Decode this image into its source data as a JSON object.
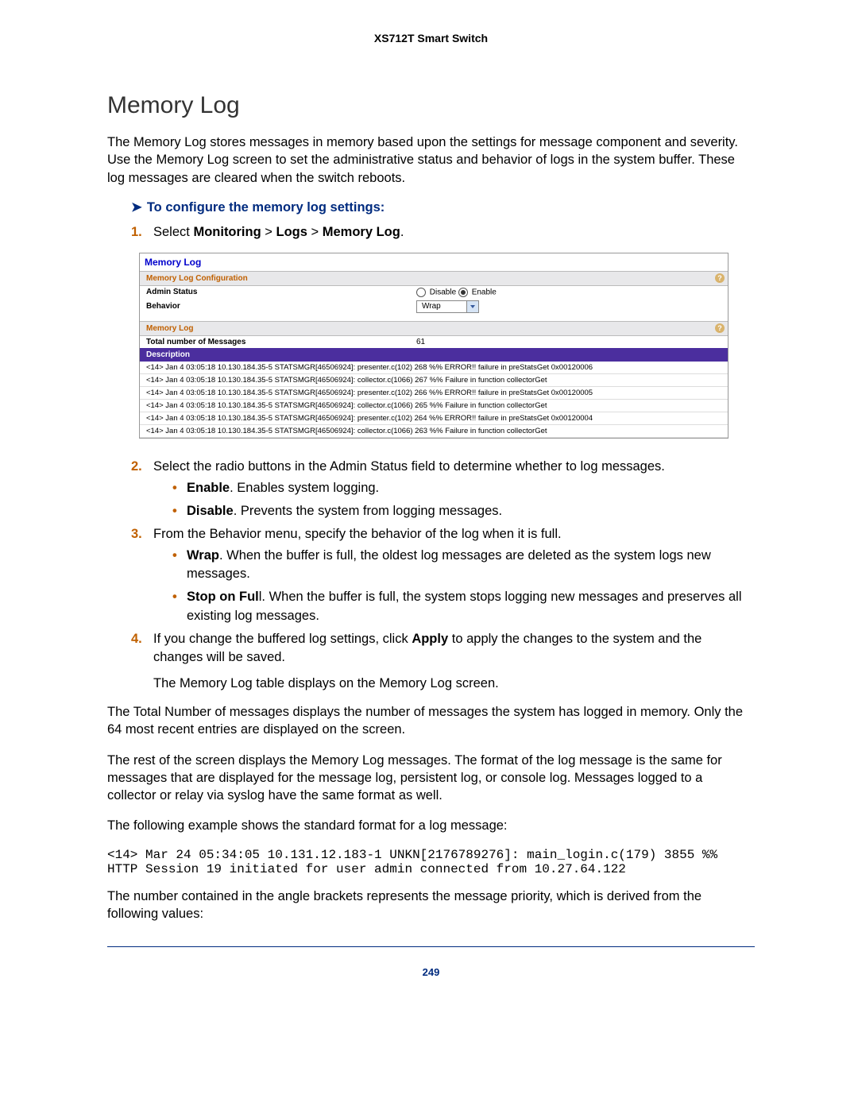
{
  "doc_header": "XS712T Smart Switch",
  "h1": "Memory Log",
  "intro": "The Memory Log stores messages in memory based upon the settings for message component and severity. Use the Memory Log screen to set the administrative status and behavior of logs in the system buffer. These log messages are cleared when the switch reboots.",
  "proc_title": "To configure the memory log settings:",
  "step1_a": "Select ",
  "step1_b": "Monitoring",
  "step1_c": " > ",
  "step1_d": "Logs",
  "step1_e": " > ",
  "step1_f": "Memory Log",
  "step1_g": ".",
  "screenshot": {
    "panel_title": "Memory Log",
    "section1": "Memory Log Configuration",
    "admin_status_label": "Admin Status",
    "disable_label": "Disable",
    "enable_label": "Enable",
    "behavior_label": "Behavior",
    "behavior_value": "Wrap",
    "section2": "Memory Log",
    "total_label": "Total number of Messages",
    "total_value": "61",
    "desc_head": "Description",
    "lines": [
      "<14> Jan 4 03:05:18 10.130.184.35-5 STATSMGR[46506924]: presenter.c(102) 268 %% ERROR!! failure in preStatsGet 0x00120006",
      "<14> Jan 4 03:05:18 10.130.184.35-5 STATSMGR[46506924]: collector.c(1066) 267 %% Failure in function collectorGet",
      "<14> Jan 4 03:05:18 10.130.184.35-5 STATSMGR[46506924]: presenter.c(102) 266 %% ERROR!! failure in preStatsGet 0x00120005",
      "<14> Jan 4 03:05:18 10.130.184.35-5 STATSMGR[46506924]: collector.c(1066) 265 %% Failure in function collectorGet",
      "<14> Jan 4 03:05:18 10.130.184.35-5 STATSMGR[46506924]: presenter.c(102) 264 %% ERROR!! failure in preStatsGet 0x00120004",
      "<14> Jan 4 03:05:18 10.130.184.35-5 STATSMGR[46506924]: collector.c(1066) 263 %% Failure in function collectorGet"
    ]
  },
  "step2": "Select the radio buttons in the Admin Status field to determine whether to log messages.",
  "step2_b1_a": "Enable",
  "step2_b1_b": ". Enables system logging.",
  "step2_b2_a": "Disable",
  "step2_b2_b": ". Prevents the system from logging messages.",
  "step3": "From the Behavior menu, specify the behavior of the log when it is full.",
  "step3_b1_a": "Wrap",
  "step3_b1_b": ". When the buffer is full, the oldest log messages are deleted as the system logs new messages.",
  "step3_b2_a": "Stop on Ful",
  "step3_b2_b": "l. When the buffer is full, the system stops logging new messages and preserves all existing log messages.",
  "step4_a": "If you change the buffered log settings, click ",
  "step4_b": "Apply",
  "step4_c": " to apply the changes to the system and the changes will be saved.",
  "step4_note": "The Memory Log table displays on the Memory Log screen.",
  "para_total": "The Total Number of messages displays the number of messages the system has logged in memory. Only the 64 most recent entries are displayed on the screen.",
  "para_rest": "The rest of the screen displays the Memory Log messages. The format of the log message is the same for messages that are displayed for the message log, persistent log, or console log. Messages logged to a collector or relay via syslog have the same format as well.",
  "para_example": "The following example shows the standard format for a log message:",
  "code_example": "<14> Mar 24 05:34:05 10.131.12.183-1 UNKN[2176789276]: main_login.c(179) 3855 %% HTTP Session 19 initiated for user admin connected from 10.27.64.122",
  "para_priority": "The number contained in the angle brackets represents the message priority, which is derived from the following values:",
  "page_num": "249"
}
